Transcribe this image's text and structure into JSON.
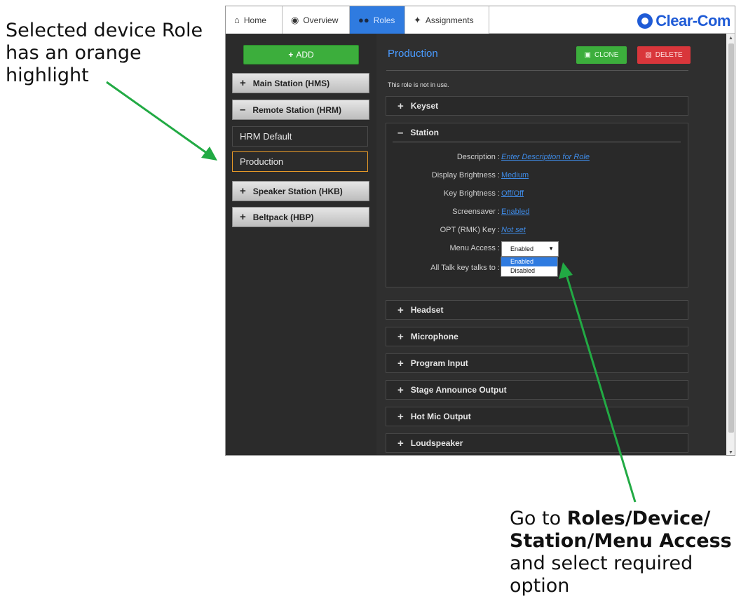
{
  "annotations": {
    "left_note": "Selected device Role has an orange highlight",
    "right_note_prefix": "Go to ",
    "right_note_bold": "Roles/Device/ Station/Menu Access",
    "right_note_suffix": " and select required option",
    "arrow_color": "#22aa44"
  },
  "tabs": [
    {
      "label": "Home",
      "icon": "home-icon"
    },
    {
      "label": "Overview",
      "icon": "globe-icon"
    },
    {
      "label": "Roles",
      "icon": "users-icon",
      "active": true
    },
    {
      "label": "Assignments",
      "icon": "assignments-icon"
    }
  ],
  "brand": "Clear-Com",
  "sidebar": {
    "add_label": "ADD",
    "groups": [
      {
        "label": "Main Station (HMS)",
        "expanded": false
      },
      {
        "label": "Remote Station (HRM)",
        "expanded": true
      },
      {
        "label": "Speaker Station (HKB)",
        "expanded": false
      },
      {
        "label": "Beltpack (HBP)",
        "expanded": false
      }
    ],
    "roles": [
      {
        "label": "HRM Default",
        "selected": false
      },
      {
        "label": "Production",
        "selected": true
      }
    ],
    "selected_color": "#e89a28"
  },
  "main": {
    "role_name": "Production",
    "clone_label": "CLONE",
    "delete_label": "DELETE",
    "usage_note": "This role is not in use.",
    "sections": [
      {
        "label": "Keyset"
      },
      {
        "label": "Station"
      },
      {
        "label": "Headset"
      },
      {
        "label": "Microphone"
      },
      {
        "label": "Program Input"
      },
      {
        "label": "Stage Announce Output"
      },
      {
        "label": "Hot Mic Output"
      },
      {
        "label": "Loudspeaker"
      }
    ],
    "station_fields": [
      {
        "label": "Description :",
        "value": "Enter Description for Role"
      },
      {
        "label": "Display Brightness :",
        "value": "Medium"
      },
      {
        "label": "Key Brightness :",
        "value": "Off/Off"
      },
      {
        "label": "Screensaver :",
        "value": "Enabled"
      },
      {
        "label": "OPT (RMK) Key :",
        "value": "Not set"
      },
      {
        "label": "Menu Access :",
        "value": "Enabled"
      },
      {
        "label": "All Talk key talks to :",
        "value": ""
      }
    ],
    "menu_access_options": [
      "Enabled",
      "Disabled"
    ]
  }
}
